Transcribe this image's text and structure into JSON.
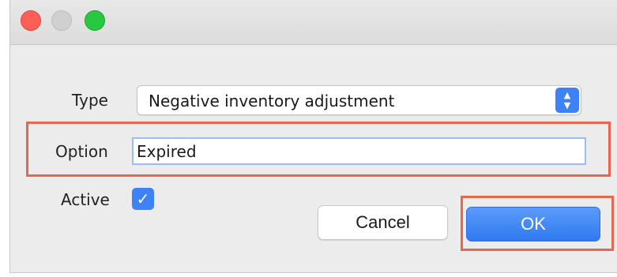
{
  "window": {
    "controls": [
      "close",
      "minimize",
      "maximize"
    ]
  },
  "form": {
    "type_label": "Type",
    "type_value": "Negative inventory adjustment",
    "option_label": "Option",
    "option_value": "Expired",
    "active_label": "Active",
    "active_checked": true
  },
  "buttons": {
    "cancel_label": "Cancel",
    "ok_label": "OK"
  },
  "colors": {
    "accent": "#3d82f7",
    "highlight": "#e8664d",
    "close": "#fd5f57",
    "maximize": "#28c840"
  },
  "icons": {
    "checkmark": "✓",
    "stepper_up": "▲",
    "stepper_down": "▼"
  }
}
